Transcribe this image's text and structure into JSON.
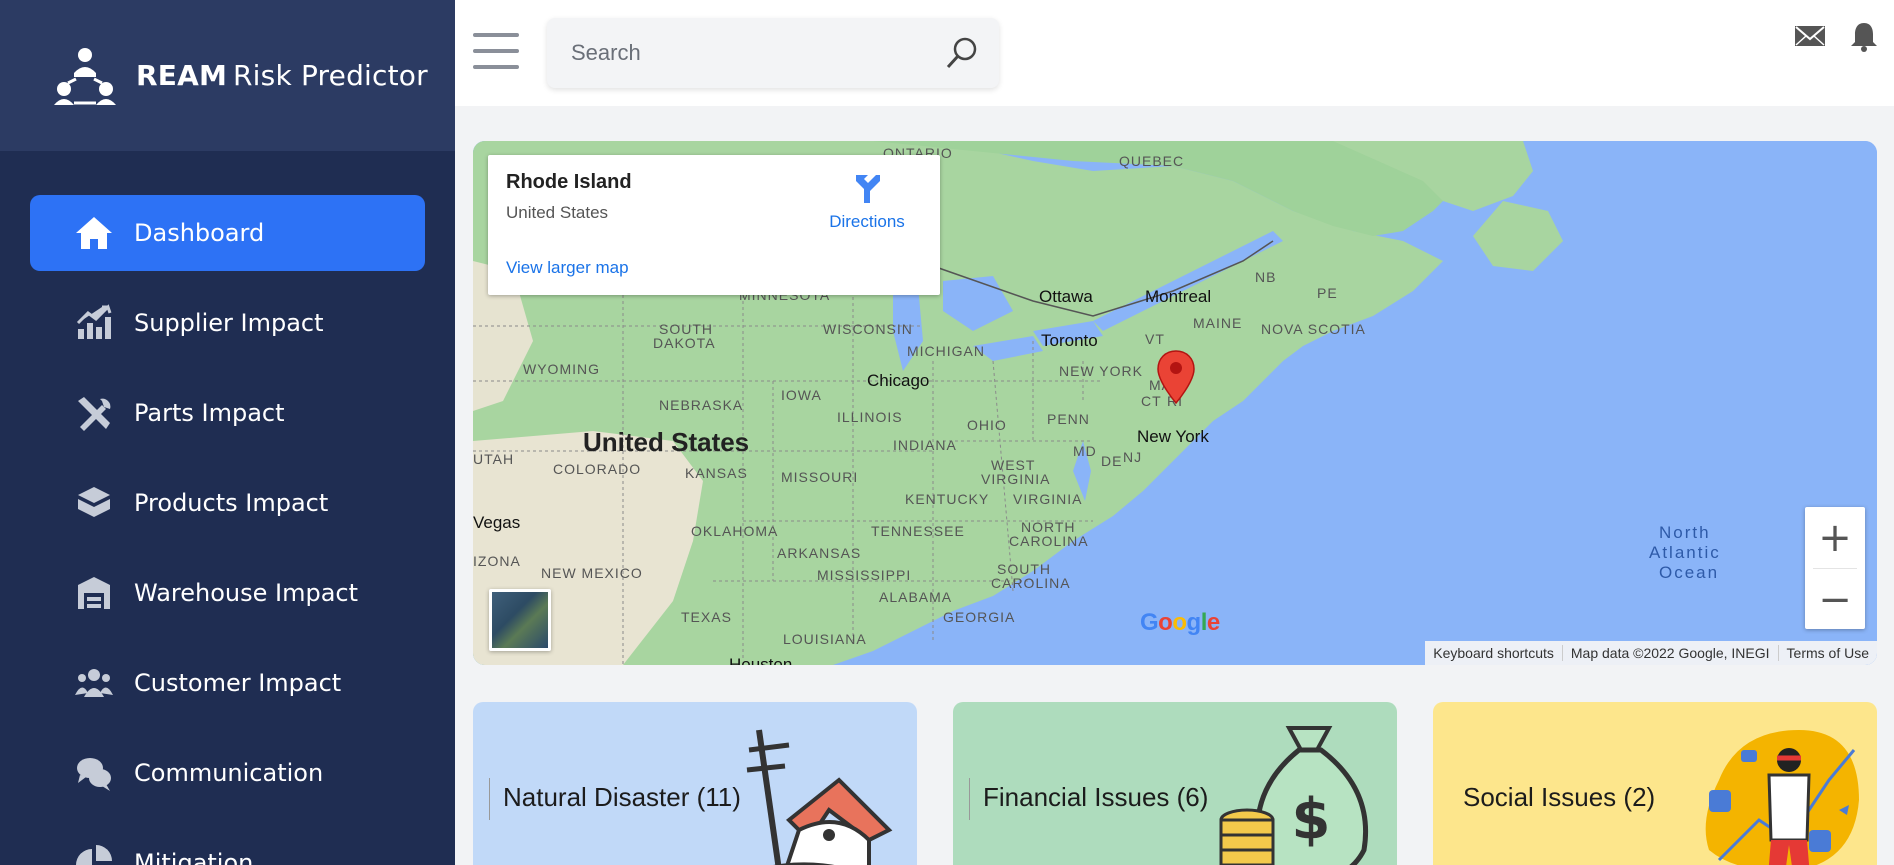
{
  "brand": {
    "bold": "REAM",
    "rest": "Risk Predictor"
  },
  "sidebar": {
    "items": [
      {
        "label": "Dashboard",
        "icon": "home-icon",
        "active": true
      },
      {
        "label": "Supplier Impact",
        "icon": "chart-growth-icon"
      },
      {
        "label": "Parts Impact",
        "icon": "tools-icon"
      },
      {
        "label": "Products Impact",
        "icon": "boxes-icon"
      },
      {
        "label": "Warehouse Impact",
        "icon": "warehouse-icon"
      },
      {
        "label": "Customer Impact",
        "icon": "users-icon"
      },
      {
        "label": "Communication",
        "icon": "chat-icon"
      },
      {
        "label": "Mitigation",
        "icon": "pie-chart-icon"
      }
    ]
  },
  "header": {
    "search_placeholder": "Search",
    "icons": [
      "menu-icon",
      "search-icon",
      "mail-icon",
      "bell-icon"
    ]
  },
  "map": {
    "info_title": "Rhode Island",
    "info_subtitle": "United States",
    "directions_label": "Directions",
    "view_larger": "View larger map",
    "zoom_in": "+",
    "zoom_out": "−",
    "footer": {
      "shortcuts": "Keyboard shortcuts",
      "data": "Map data ©2022 Google, INEGI",
      "terms": "Terms of Use"
    },
    "labels": {
      "ontario": "ONTARIO",
      "quebec": "QUEBEC",
      "nb": "NB",
      "pe": "PE",
      "ottawa": "Ottawa",
      "montreal": "Montreal",
      "maine": "MAINE",
      "nova_scotia": "NOVA SCOTIA",
      "minnesota": "MINNESOTA",
      "south_dakota_1": "SOUTH",
      "south_dakota_2": "DAKOTA",
      "wisconsin": "WISCONSIN",
      "michigan": "MICHIGAN",
      "toronto": "Toronto",
      "vt": "VT",
      "wyoming": "WYOMING",
      "nebraska": "NEBRASKA",
      "iowa": "IOWA",
      "chicago": "Chicago",
      "new_york_state": "NEW YORK",
      "ma": "MA",
      "ct": "CT",
      "ri": "RI",
      "united_states": "United States",
      "illinois": "ILLINOIS",
      "ohio": "OHIO",
      "penn": "PENN",
      "new_york_city": "New York",
      "utah": "UTAH",
      "colorado": "COLORADO",
      "kansas": "KANSAS",
      "indiana": "INDIANA",
      "md": "MD",
      "de": "DE",
      "nj": "NJ",
      "missouri": "MISSOURI",
      "west_virginia_1": "WEST",
      "west_virginia_2": "VIRGINIA",
      "kentucky": "KENTUCKY",
      "virginia": "VIRGINIA",
      "vegas": "Vegas",
      "oklahoma": "OKLAHOMA",
      "tennessee": "TENNESSEE",
      "north_carolina_1": "NORTH",
      "north_carolina_2": "CAROLINA",
      "arizona": "IZONA",
      "new_mexico": "NEW MEXICO",
      "arkansas": "ARKANSAS",
      "mississippi": "MISSISSIPPI",
      "south_carolina_1": "SOUTH",
      "south_carolina_2": "CAROLINA",
      "alabama": "ALABAMA",
      "georgia": "GEORGIA",
      "texas": "TEXAS",
      "louisiana": "LOUISIANA",
      "houston": "Houston",
      "ocean_1": "North",
      "ocean_2": "Atlantic",
      "ocean_3": "Ocean"
    }
  },
  "cards": [
    {
      "title": "Natural Disaster (11)",
      "color": "#c1d9f8",
      "art": "disaster-illustration-icon"
    },
    {
      "title": "Financial Issues (6)",
      "color": "#aedcbd",
      "art": "money-bag-icon"
    },
    {
      "title": "Social Issues (2)",
      "color": "#fde68c",
      "art": "social-media-person-icon"
    }
  ],
  "colors": {
    "sidebar": "#1f2d52",
    "brand_bar": "#2c3b63",
    "active": "#2d72f5",
    "water": "#8ab4f8",
    "land": "#a8d5a0"
  }
}
